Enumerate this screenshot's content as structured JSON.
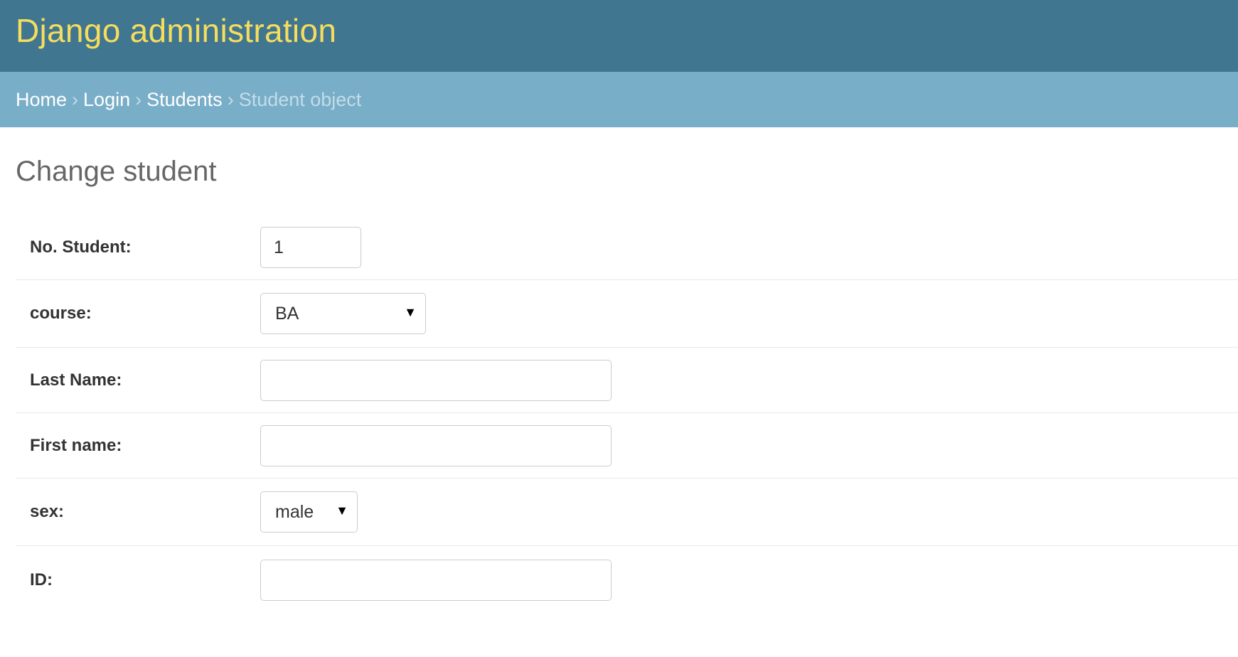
{
  "header": {
    "site_name": "Django administration"
  },
  "breadcrumbs": {
    "items": [
      "Home",
      "Login",
      "Students"
    ],
    "separator": "›",
    "current": "Student object"
  },
  "page": {
    "title": "Change student"
  },
  "form": {
    "no_student": {
      "label": "No. Student:",
      "value": "1"
    },
    "course": {
      "label": "course:",
      "selected": "BA"
    },
    "last_name": {
      "label": "Last Name:",
      "value": ""
    },
    "first_name": {
      "label": "First name:",
      "value": ""
    },
    "sex": {
      "label": "sex:",
      "selected": "male"
    },
    "id": {
      "label": "ID:",
      "value": ""
    }
  },
  "icons": {
    "dropdown": "▼"
  },
  "colors": {
    "header_bg": "#417690",
    "site_name": "#f5dd5d",
    "breadcrumbs_bg": "#79aec8",
    "breadcrumbs_current": "#c4dce8",
    "page_title": "#666666"
  }
}
